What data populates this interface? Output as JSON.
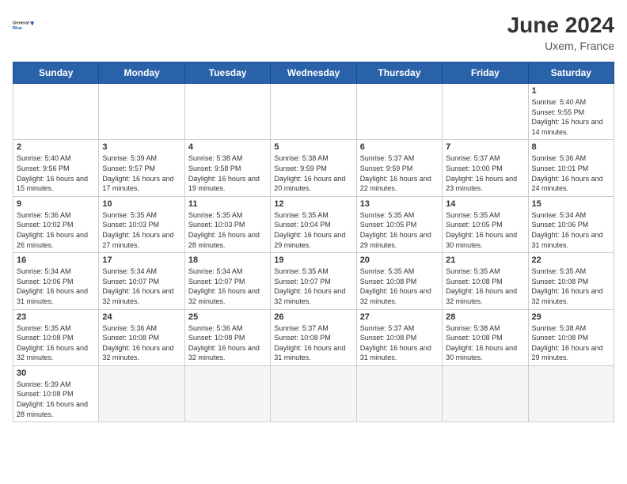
{
  "header": {
    "logo_line1": "General",
    "logo_line2": "Blue",
    "title": "June 2024",
    "location": "Uxem, France"
  },
  "weekdays": [
    "Sunday",
    "Monday",
    "Tuesday",
    "Wednesday",
    "Thursday",
    "Friday",
    "Saturday"
  ],
  "days": {
    "d1": {
      "num": "1",
      "sunrise": "Sunrise: 5:40 AM",
      "sunset": "Sunset: 9:55 PM",
      "daylight": "Daylight: 16 hours and 14 minutes."
    },
    "d2": {
      "num": "2",
      "sunrise": "Sunrise: 5:40 AM",
      "sunset": "Sunset: 9:56 PM",
      "daylight": "Daylight: 16 hours and 15 minutes."
    },
    "d3": {
      "num": "3",
      "sunrise": "Sunrise: 5:39 AM",
      "sunset": "Sunset: 9:57 PM",
      "daylight": "Daylight: 16 hours and 17 minutes."
    },
    "d4": {
      "num": "4",
      "sunrise": "Sunrise: 5:38 AM",
      "sunset": "Sunset: 9:58 PM",
      "daylight": "Daylight: 16 hours and 19 minutes."
    },
    "d5": {
      "num": "5",
      "sunrise": "Sunrise: 5:38 AM",
      "sunset": "Sunset: 9:59 PM",
      "daylight": "Daylight: 16 hours and 20 minutes."
    },
    "d6": {
      "num": "6",
      "sunrise": "Sunrise: 5:37 AM",
      "sunset": "Sunset: 9:59 PM",
      "daylight": "Daylight: 16 hours and 22 minutes."
    },
    "d7": {
      "num": "7",
      "sunrise": "Sunrise: 5:37 AM",
      "sunset": "Sunset: 10:00 PM",
      "daylight": "Daylight: 16 hours and 23 minutes."
    },
    "d8": {
      "num": "8",
      "sunrise": "Sunrise: 5:36 AM",
      "sunset": "Sunset: 10:01 PM",
      "daylight": "Daylight: 16 hours and 24 minutes."
    },
    "d9": {
      "num": "9",
      "sunrise": "Sunrise: 5:36 AM",
      "sunset": "Sunset: 10:02 PM",
      "daylight": "Daylight: 16 hours and 26 minutes."
    },
    "d10": {
      "num": "10",
      "sunrise": "Sunrise: 5:35 AM",
      "sunset": "Sunset: 10:03 PM",
      "daylight": "Daylight: 16 hours and 27 minutes."
    },
    "d11": {
      "num": "11",
      "sunrise": "Sunrise: 5:35 AM",
      "sunset": "Sunset: 10:03 PM",
      "daylight": "Daylight: 16 hours and 28 minutes."
    },
    "d12": {
      "num": "12",
      "sunrise": "Sunrise: 5:35 AM",
      "sunset": "Sunset: 10:04 PM",
      "daylight": "Daylight: 16 hours and 29 minutes."
    },
    "d13": {
      "num": "13",
      "sunrise": "Sunrise: 5:35 AM",
      "sunset": "Sunset: 10:05 PM",
      "daylight": "Daylight: 16 hours and 29 minutes."
    },
    "d14": {
      "num": "14",
      "sunrise": "Sunrise: 5:35 AM",
      "sunset": "Sunset: 10:05 PM",
      "daylight": "Daylight: 16 hours and 30 minutes."
    },
    "d15": {
      "num": "15",
      "sunrise": "Sunrise: 5:34 AM",
      "sunset": "Sunset: 10:06 PM",
      "daylight": "Daylight: 16 hours and 31 minutes."
    },
    "d16": {
      "num": "16",
      "sunrise": "Sunrise: 5:34 AM",
      "sunset": "Sunset: 10:06 PM",
      "daylight": "Daylight: 16 hours and 31 minutes."
    },
    "d17": {
      "num": "17",
      "sunrise": "Sunrise: 5:34 AM",
      "sunset": "Sunset: 10:07 PM",
      "daylight": "Daylight: 16 hours and 32 minutes."
    },
    "d18": {
      "num": "18",
      "sunrise": "Sunrise: 5:34 AM",
      "sunset": "Sunset: 10:07 PM",
      "daylight": "Daylight: 16 hours and 32 minutes."
    },
    "d19": {
      "num": "19",
      "sunrise": "Sunrise: 5:35 AM",
      "sunset": "Sunset: 10:07 PM",
      "daylight": "Daylight: 16 hours and 32 minutes."
    },
    "d20": {
      "num": "20",
      "sunrise": "Sunrise: 5:35 AM",
      "sunset": "Sunset: 10:08 PM",
      "daylight": "Daylight: 16 hours and 32 minutes."
    },
    "d21": {
      "num": "21",
      "sunrise": "Sunrise: 5:35 AM",
      "sunset": "Sunset: 10:08 PM",
      "daylight": "Daylight: 16 hours and 32 minutes."
    },
    "d22": {
      "num": "22",
      "sunrise": "Sunrise: 5:35 AM",
      "sunset": "Sunset: 10:08 PM",
      "daylight": "Daylight: 16 hours and 32 minutes."
    },
    "d23": {
      "num": "23",
      "sunrise": "Sunrise: 5:35 AM",
      "sunset": "Sunset: 10:08 PM",
      "daylight": "Daylight: 16 hours and 32 minutes."
    },
    "d24": {
      "num": "24",
      "sunrise": "Sunrise: 5:36 AM",
      "sunset": "Sunset: 10:08 PM",
      "daylight": "Daylight: 16 hours and 32 minutes."
    },
    "d25": {
      "num": "25",
      "sunrise": "Sunrise: 5:36 AM",
      "sunset": "Sunset: 10:08 PM",
      "daylight": "Daylight: 16 hours and 32 minutes."
    },
    "d26": {
      "num": "26",
      "sunrise": "Sunrise: 5:37 AM",
      "sunset": "Sunset: 10:08 PM",
      "daylight": "Daylight: 16 hours and 31 minutes."
    },
    "d27": {
      "num": "27",
      "sunrise": "Sunrise: 5:37 AM",
      "sunset": "Sunset: 10:08 PM",
      "daylight": "Daylight: 16 hours and 31 minutes."
    },
    "d28": {
      "num": "28",
      "sunrise": "Sunrise: 5:38 AM",
      "sunset": "Sunset: 10:08 PM",
      "daylight": "Daylight: 16 hours and 30 minutes."
    },
    "d29": {
      "num": "29",
      "sunrise": "Sunrise: 5:38 AM",
      "sunset": "Sunset: 10:08 PM",
      "daylight": "Daylight: 16 hours and 29 minutes."
    },
    "d30": {
      "num": "30",
      "sunrise": "Sunrise: 5:39 AM",
      "sunset": "Sunset: 10:08 PM",
      "daylight": "Daylight: 16 hours and 28 minutes."
    }
  }
}
